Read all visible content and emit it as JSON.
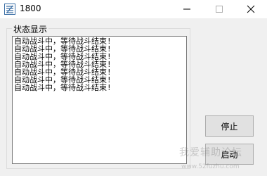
{
  "window": {
    "title": "1800",
    "app_icon": "app-icon",
    "controls": {
      "minimize_icon": "minimize-icon",
      "maximize_icon": "maximize-icon",
      "close_icon": "close-icon"
    }
  },
  "status": {
    "group_label": "状态显示",
    "log_lines": [
      "自动战斗中，等待战斗结束!",
      "自动战斗中，等待战斗结束!",
      "自动战斗中，等待战斗结束!",
      "自动战斗中，等待战斗结束!",
      "自动战斗中，等待战斗结束!",
      "自动战斗中，等待战斗结束!",
      "自动战斗中，等待战斗结束!"
    ]
  },
  "buttons": {
    "stop_label": "停止",
    "start_label": "启动"
  },
  "watermark": {
    "text": "我爱辅助论坛",
    "url": "www.52fuzhu.com"
  }
}
